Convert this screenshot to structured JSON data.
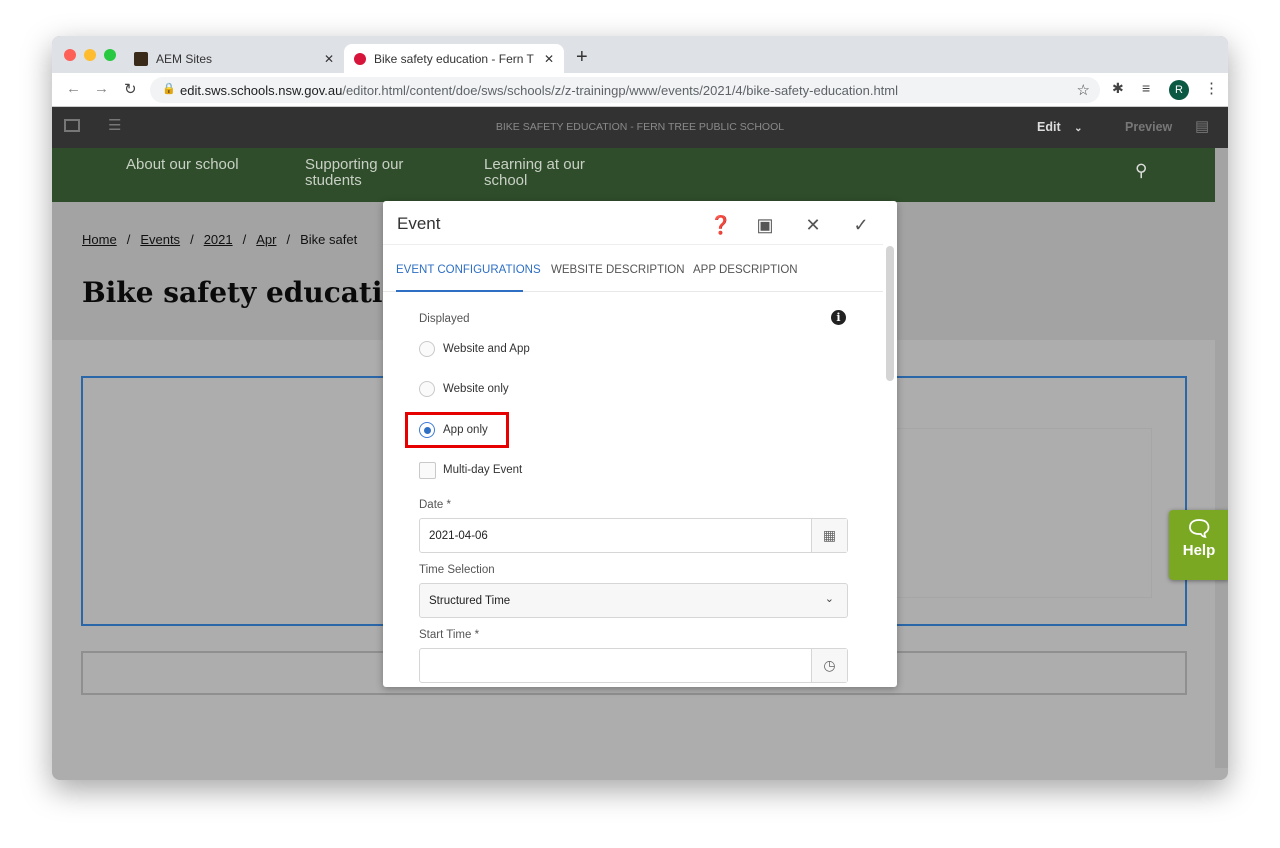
{
  "browser": {
    "tabs": [
      {
        "label": "AEM Sites",
        "active": false
      },
      {
        "label": "Bike safety education - Fern Tr",
        "active": true
      }
    ],
    "url_host": "edit.sws.schools.nsw.gov.au",
    "url_path": "/editor.html/content/doe/sws/schools/z/z-trainingp/www/events/2021/4/bike-safety-education.html",
    "profile_initial": "R",
    "profile_color": "#0b5843"
  },
  "aem_toolbar": {
    "page_title": "BIKE SAFETY EDUCATION - FERN TREE PUBLIC SCHOOL",
    "mode": "Edit",
    "preview": "Preview"
  },
  "site_nav": {
    "items": [
      "About our school",
      "Supporting our students",
      "Learning at our school"
    ]
  },
  "breadcrumb": [
    "Home",
    "Events",
    "2021",
    "Apr",
    "Bike safet"
  ],
  "page_title": "Bike safety educatio",
  "help_label": "Help",
  "dialog": {
    "title": "Event",
    "tabs": [
      {
        "label": "EVENT CONFIGURATIONS",
        "active": true
      },
      {
        "label": "WEBSITE DESCRIPTION",
        "active": false
      },
      {
        "label": "APP DESCRIPTION",
        "active": false
      }
    ],
    "displayed_label": "Displayed",
    "options": [
      {
        "label": "Website and App",
        "selected": false
      },
      {
        "label": "Website only",
        "selected": false
      },
      {
        "label": "App only",
        "selected": true
      }
    ],
    "multiday_label": "Multi-day Event",
    "multiday_checked": false,
    "date_label": "Date *",
    "date_value": "2021-04-06",
    "time_selection_label": "Time Selection",
    "time_selection_value": "Structured Time",
    "start_time_label": "Start Time *",
    "start_time_value": "",
    "accent": "#2e6fc4",
    "highlight_color": "#e60000"
  }
}
